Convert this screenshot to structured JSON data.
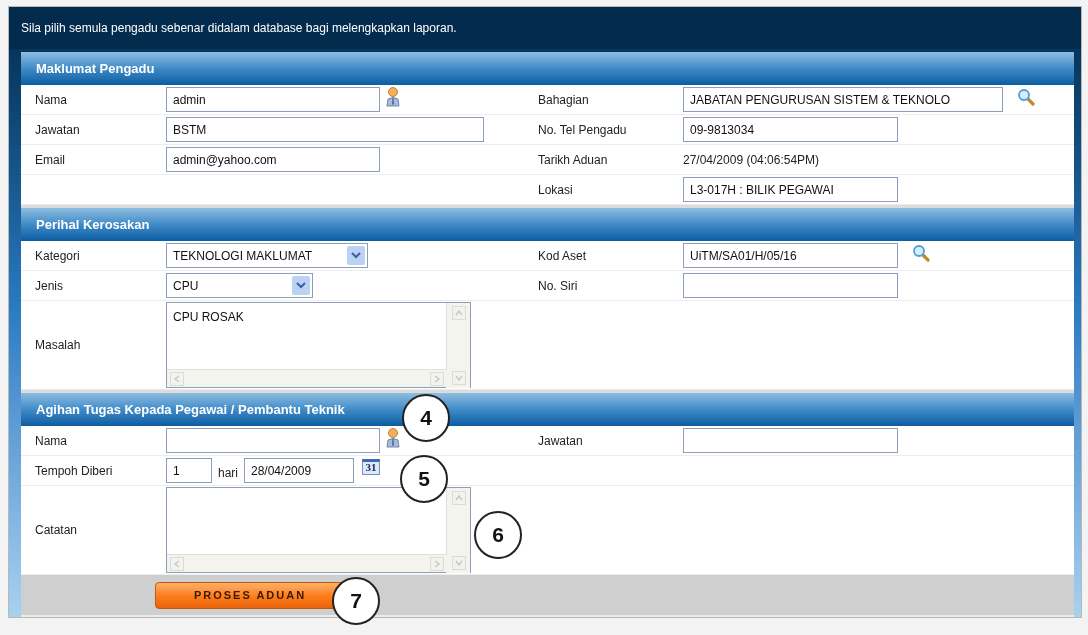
{
  "instruction": "Sila pilih semula pengadu sebenar didalam database bagi melengkapkan laporan.",
  "sections": [
    {
      "title": "Maklumat Pengadu",
      "rows": [
        {
          "left": {
            "label": "Nama",
            "kind": "text",
            "value": "admin"
          },
          "right": {
            "label": "Bahagian",
            "kind": "text",
            "value": "JABATAN PENGURUSAN SISTEM & TEKNOLO"
          }
        },
        {
          "left": {
            "label": "Jawatan",
            "kind": "text",
            "value": "BSTM"
          },
          "right": {
            "label": "No. Tel Pengadu",
            "kind": "text",
            "value": "09-9813034"
          }
        },
        {
          "left": {
            "label": "Email",
            "kind": "text",
            "value": "admin@yahoo.com"
          },
          "right": {
            "label": "Tarikh Aduan",
            "kind": "static",
            "value": "27/04/2009 (04:06:54PM)"
          }
        },
        {
          "right": {
            "label": "Lokasi",
            "kind": "text",
            "value": "L3-017H : BILIK PEGAWAI"
          }
        }
      ]
    },
    {
      "title": "Perihal Kerosakan",
      "rows": [
        {
          "left": {
            "label": "Kategori",
            "kind": "select",
            "value": "TEKNOLOGI MAKLUMAT"
          },
          "right": {
            "label": "Kod Aset",
            "kind": "text",
            "value": "UiTM/SA01/H/05/16"
          }
        },
        {
          "left": {
            "label": "Jenis",
            "kind": "select",
            "value": "CPU"
          },
          "right": {
            "label": "No. Siri",
            "kind": "text"
          }
        },
        {
          "left": {
            "label": "Masalah",
            "kind": "textarea",
            "value": "CPU ROSAK"
          }
        }
      ]
    },
    {
      "title": "Agihan Tugas Kepada Pegawai / Pembantu Teknik",
      "rows": [
        {
          "left": {
            "label": "Nama",
            "kind": "text"
          },
          "right": {
            "label": "Jawatan",
            "kind": "text"
          }
        },
        {
          "left": {
            "label": "Tempoh Diberi",
            "kind": "duration",
            "value": "1",
            "unit": "hari",
            "date": "28/04/2009",
            "calendar_day": "31"
          }
        },
        {
          "left": {
            "label": "Catatan",
            "kind": "textarea"
          }
        }
      ]
    }
  ],
  "submit_button": "PROSES ADUAN",
  "callouts": [
    "4",
    "5",
    "6",
    "7"
  ]
}
